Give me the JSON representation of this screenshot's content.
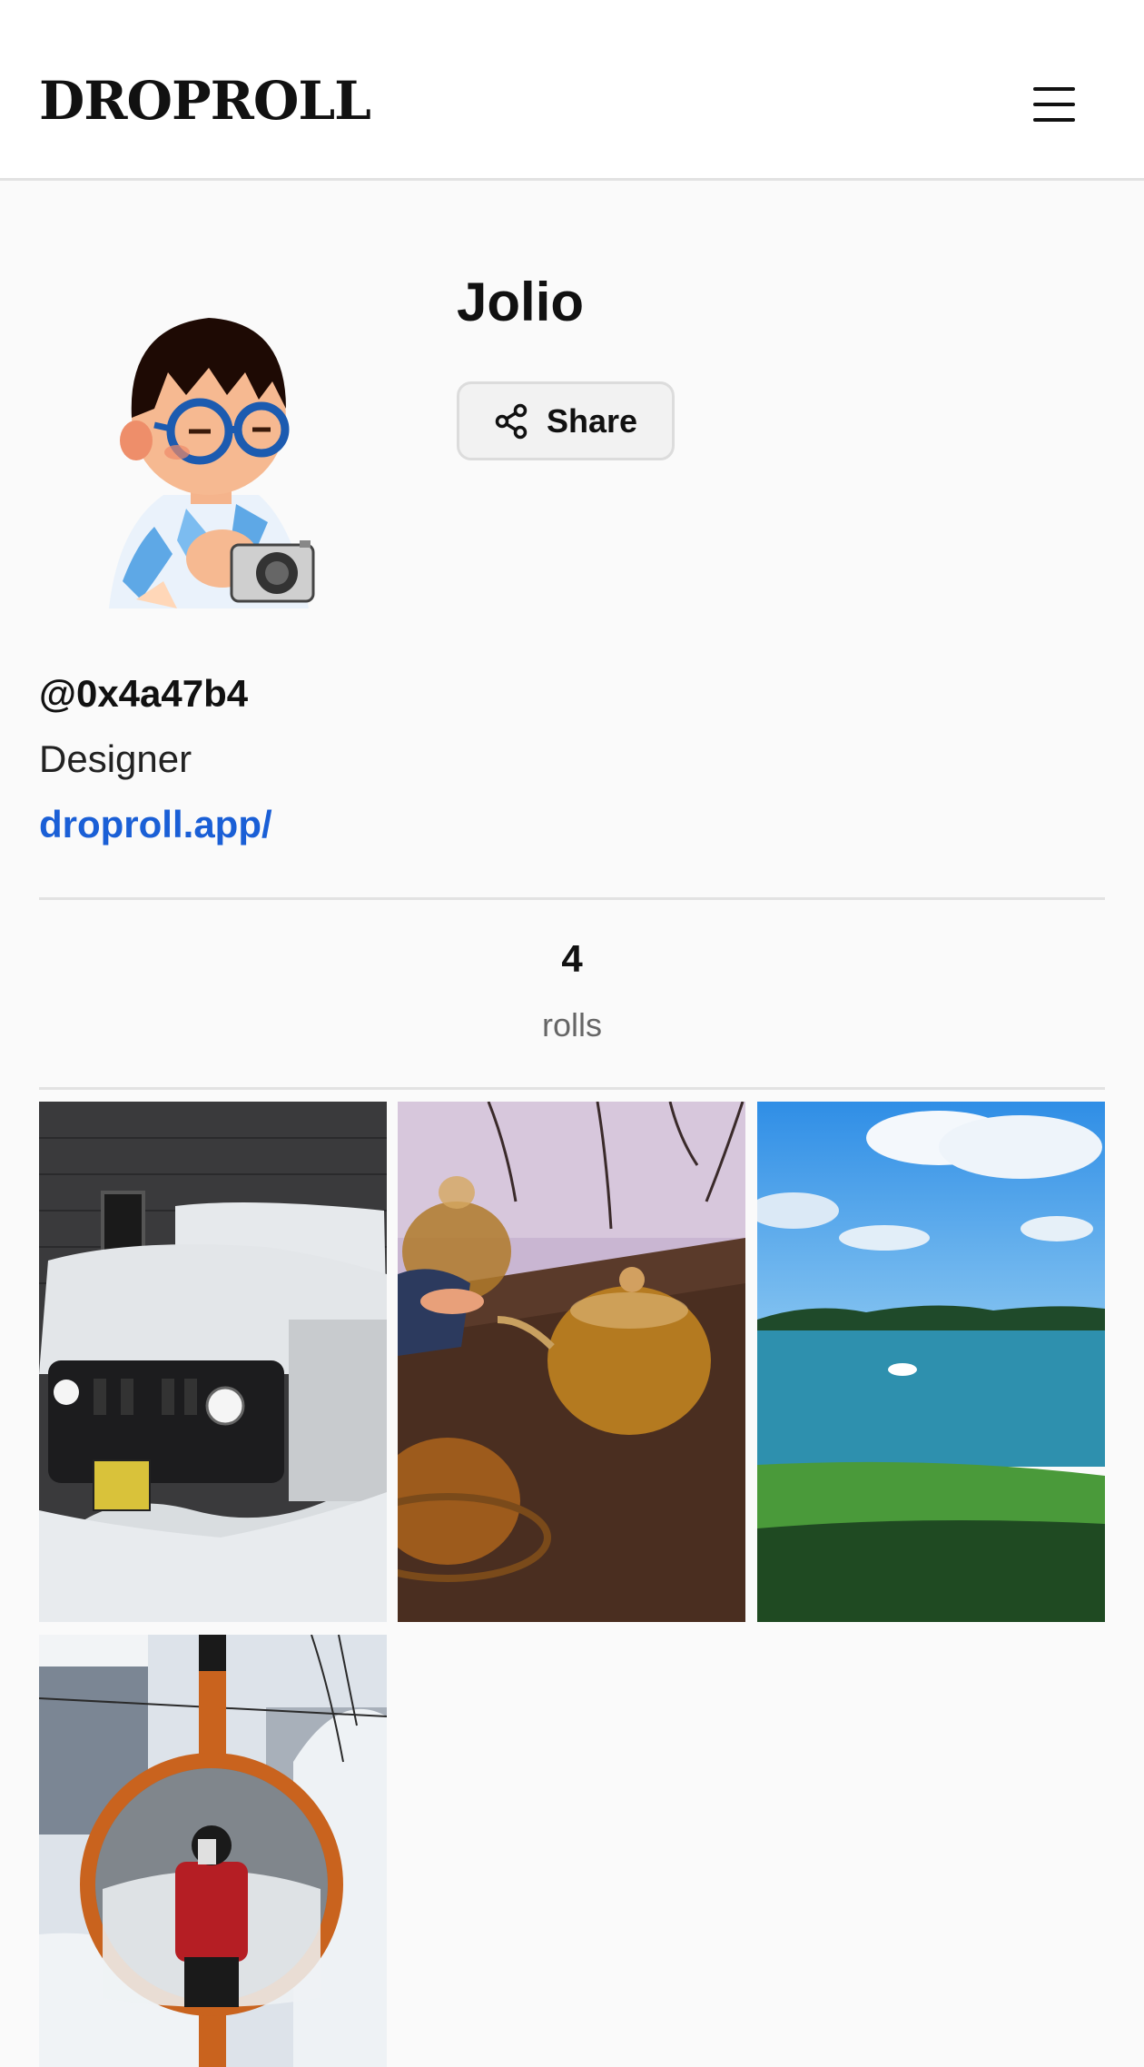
{
  "header": {
    "logo": "DROPROLL",
    "menu_icon": "hamburger-menu-icon"
  },
  "profile": {
    "name": "Jolio",
    "share_label": "Share",
    "share_icon": "share-icon",
    "handle": "@0x4a47b4",
    "bio": "Designer",
    "link": "droproll.app/"
  },
  "stats": {
    "count": "4",
    "label": "rolls"
  },
  "rolls": [
    {
      "subject": "snow-covered car"
    },
    {
      "subject": "glass teapots and tea cups"
    },
    {
      "subject": "lake with blue sky"
    },
    {
      "subject": "person in traffic mirror in snow"
    }
  ],
  "colors": {
    "link": "#1a5fd6",
    "divider": "#e2e2e2",
    "button_bg": "#f2f2f2"
  }
}
